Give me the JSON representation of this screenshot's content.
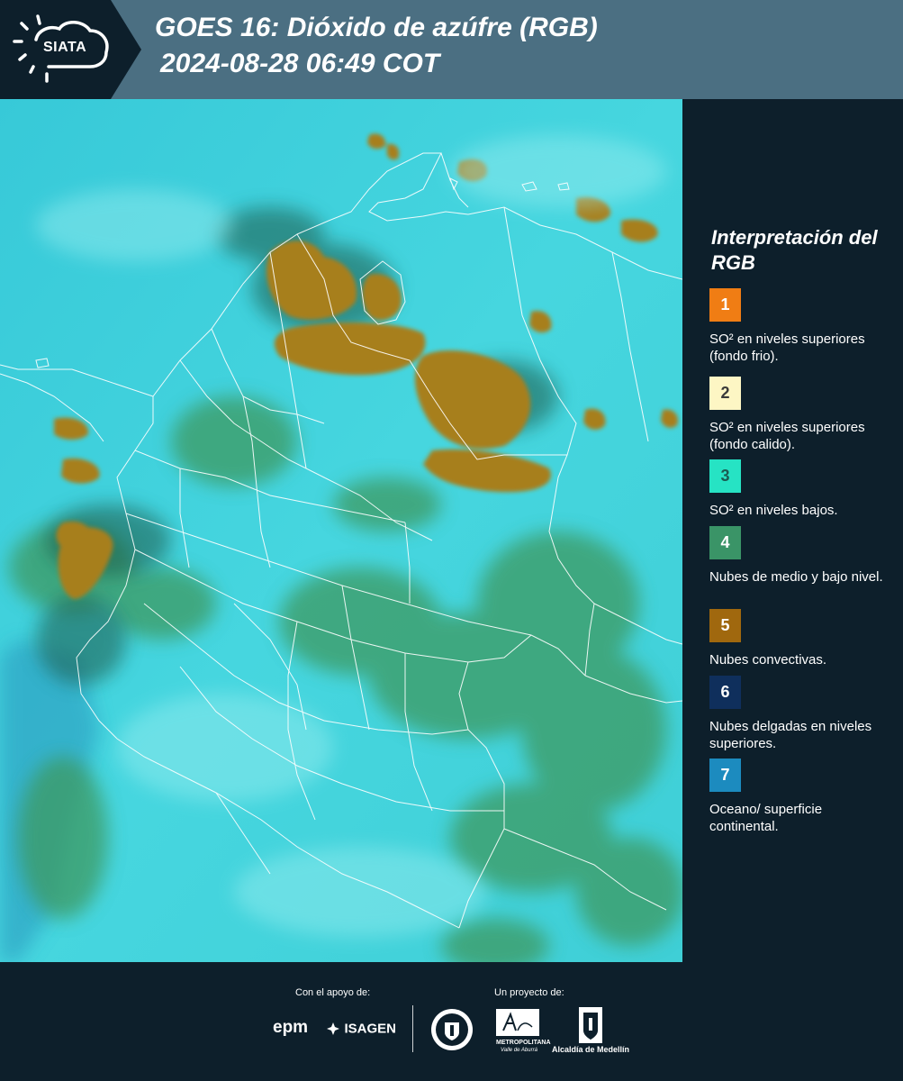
{
  "header": {
    "logo_text": "SIATA",
    "title_line1": "GOES 16: Dióxido de azúfre (RGB)",
    "title_line2": "2024-08-28 06:49 COT"
  },
  "legend": {
    "title": "Interpretación del RGB",
    "items": [
      {
        "number": "1",
        "label": "SO² en niveles superiores (fondo frio).",
        "color": "#f07d14",
        "text_color": "#ffffff"
      },
      {
        "number": "2",
        "label": "SO² en niveles superiores (fondo calido).",
        "color": "#fdf6c4",
        "text_color": "#3a3a3a"
      },
      {
        "number": "3",
        "label": "SO² en niveles bajos.",
        "color": "#26e3c4",
        "text_color": "#1b5b52"
      },
      {
        "number": "4",
        "label": "Nubes de medio y bajo nivel.",
        "color": "#3a9467",
        "text_color": "#ffffff"
      },
      {
        "number": "5",
        "label": "Nubes convectivas.",
        "color": "#a0680e",
        "text_color": "#ffffff"
      },
      {
        "number": "6",
        "label": "Nubes delgadas en niveles superiores.",
        "color": "#0f2f5c",
        "text_color": "#ffffff"
      },
      {
        "number": "7",
        "label": "Oceano/ superficie continental.",
        "color": "#1c8bbf",
        "text_color": "#ffffff"
      }
    ]
  },
  "footer": {
    "support_caption": "Con el apoyo de:",
    "project_caption": "Un proyecto de:",
    "sponsor_epm": "epm",
    "sponsor_isagen": "ISAGEN",
    "partner_area_line1": "METROPOLITANA",
    "partner_area_line2": "Valle de Aburrá",
    "partner_alcaldia": "Alcaldía de Medellín"
  },
  "colors": {
    "background": "#0d1f2b",
    "title_band": "#4b6f82",
    "ocean": "#3fd2df",
    "cloud_low": "#3d9a62",
    "cloud_convective": "#a77f1f"
  }
}
